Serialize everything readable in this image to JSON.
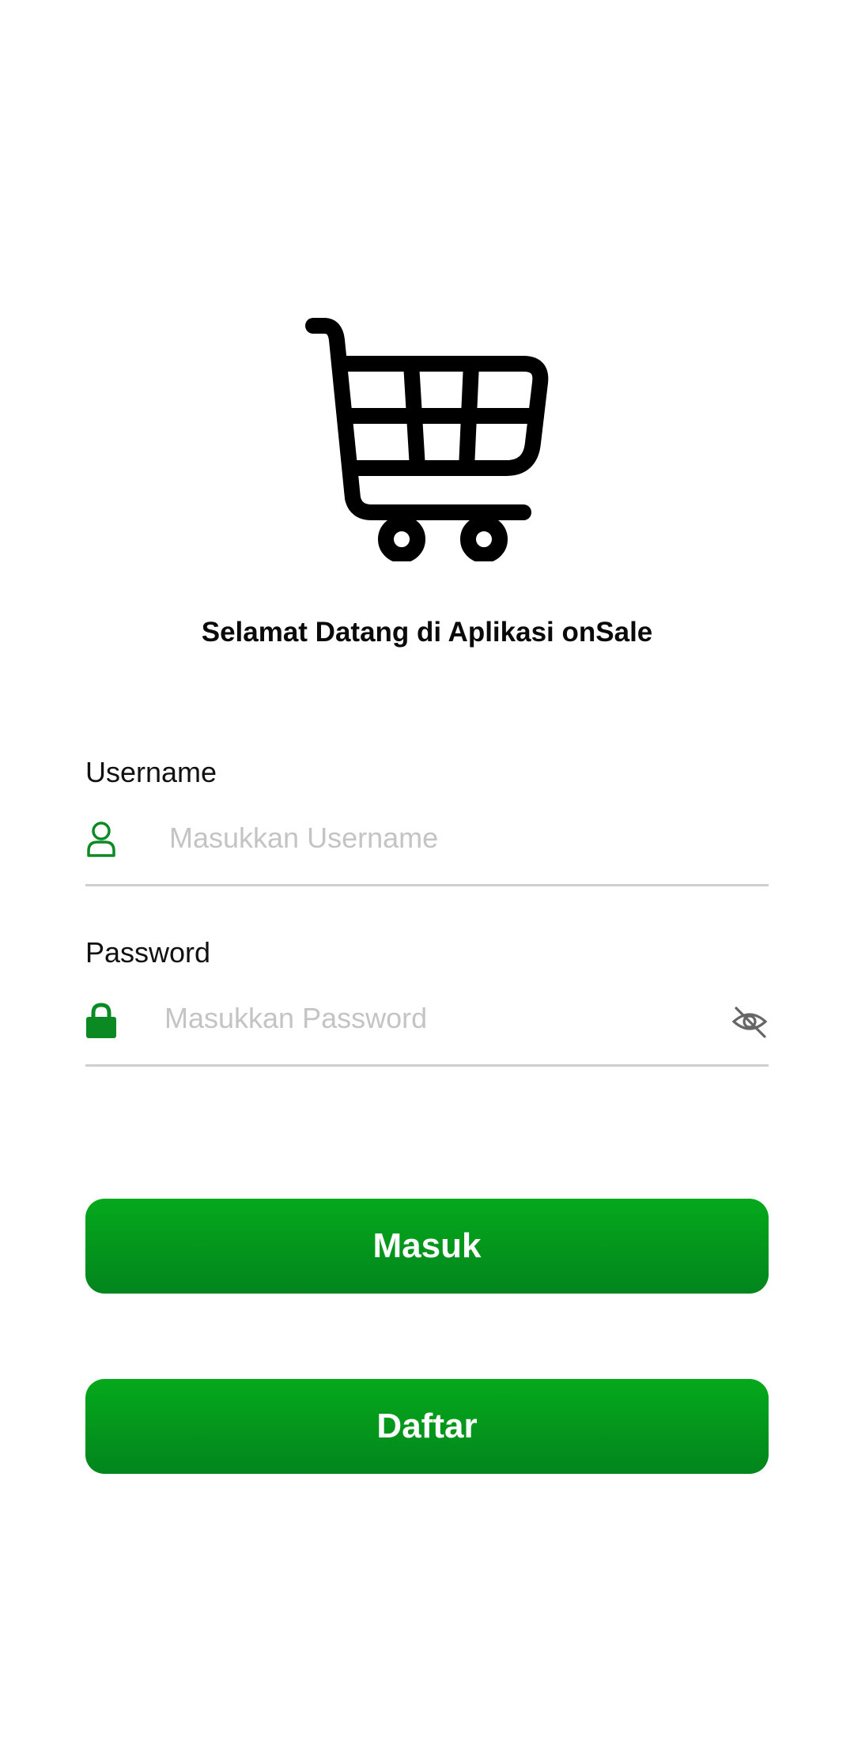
{
  "app": {
    "welcome_text": "Selamat Datang di Aplikasi onSale",
    "logo_icon": "shopping-cart-icon",
    "accent_color": "#05a91c"
  },
  "form": {
    "username": {
      "label": "Username",
      "placeholder": "Masukkan Username",
      "value": "",
      "icon": "user-icon"
    },
    "password": {
      "label": "Password",
      "placeholder": "Masukkan Password",
      "value": "",
      "icon": "lock-icon",
      "toggle_icon": "eye-off-icon"
    }
  },
  "actions": {
    "login_label": "Masuk",
    "register_label": "Daftar"
  }
}
